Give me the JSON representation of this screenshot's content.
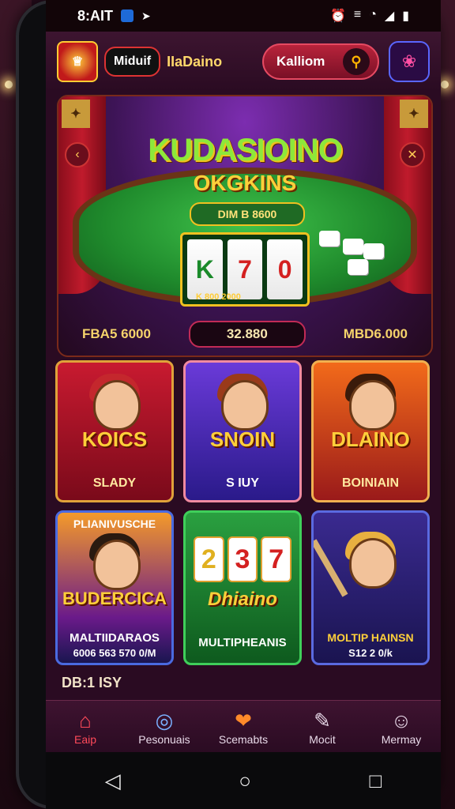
{
  "status": {
    "time": "8:AIT",
    "icons": [
      "app-icon",
      "location-icon",
      "alarm-icon",
      "vibrate-icon",
      "wifi-icon",
      "signal-icon",
      "battery-icon"
    ]
  },
  "topbar": {
    "brand_pill": "Miduif",
    "brand_name": "IIaDaino",
    "search_label": "Kalliom",
    "icons": {
      "search": "search-icon",
      "gift": "gift-icon"
    }
  },
  "hero": {
    "title": "KUDASIOINO",
    "subtitle": "OKGKINS",
    "badge": "DIM B 8600",
    "slot_reels": [
      "K",
      "7",
      "0"
    ],
    "slot_number": "K 800   2000",
    "stat_left": "FBA5 6000",
    "stat_mid": "32.880",
    "stat_right": "MBD6.000"
  },
  "cards": [
    {
      "title": "KOICS",
      "label": "SLADY",
      "bg": "#a2112a"
    },
    {
      "title": "SNOIN",
      "label": "S IUY",
      "bg": "#3a2aa8"
    },
    {
      "title": "DLAINO",
      "label": "BOINIAIN",
      "bg": "#c8341a"
    },
    {
      "title": "BUDERCICA",
      "label": "MALTIIDARAOS",
      "sub": "6006 563 570 0/M",
      "header": "PLIANIVUSCHE",
      "bg": "#3a1e6a"
    },
    {
      "title": "Dhiaino",
      "label": "MULTIPHEANIS",
      "reels": [
        "2",
        "3",
        "7"
      ],
      "bg": "#1f7a2e"
    },
    {
      "title": "",
      "label": "MOLTIP HAINSN",
      "sub": "S12 2 0/k",
      "bg": "#3a2280"
    }
  ],
  "footer_text": "DB:1 ISY",
  "nav": [
    {
      "label": "Eaip",
      "icon": "home-icon",
      "active": true
    },
    {
      "label": "Pesonuais",
      "icon": "target-icon",
      "active": false
    },
    {
      "label": "Scemabts",
      "icon": "chat-icon",
      "active": false
    },
    {
      "label": "Mocit",
      "icon": "document-icon",
      "active": false
    },
    {
      "label": "Mermay",
      "icon": "profile-icon",
      "active": false
    }
  ],
  "system_nav": {
    "back": "back-icon",
    "home": "home-circle-icon",
    "recents": "recents-icon"
  }
}
